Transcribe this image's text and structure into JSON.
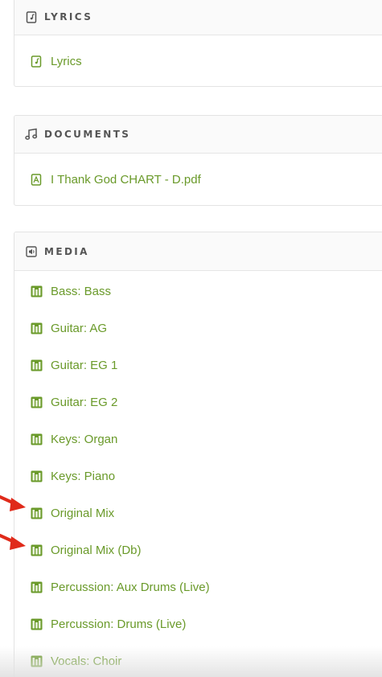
{
  "colors": {
    "link_green": "#6a9a2a",
    "header_text": "#555555",
    "border": "#e3e3e3",
    "arrow_red": "#e02a1a"
  },
  "lyrics": {
    "header_icon": "lyrics-file-icon",
    "title": "LYRICS",
    "items": [
      {
        "label": "Lyrics",
        "icon": "lyrics-file-icon"
      }
    ]
  },
  "documents": {
    "header_icon": "music-note-icon",
    "title": "DOCUMENTS",
    "items": [
      {
        "label": "I Thank God CHART - D.pdf",
        "icon": "pdf-file-icon"
      }
    ]
  },
  "media": {
    "header_icon": "speaker-icon",
    "title": "MEDIA",
    "items": [
      {
        "label": "Bass: Bass",
        "icon": "audio-grid-icon"
      },
      {
        "label": "Guitar: AG",
        "icon": "audio-grid-icon"
      },
      {
        "label": "Guitar: EG 1",
        "icon": "audio-grid-icon"
      },
      {
        "label": "Guitar: EG 2",
        "icon": "audio-grid-icon"
      },
      {
        "label": "Keys: Organ",
        "icon": "audio-grid-icon"
      },
      {
        "label": "Keys: Piano",
        "icon": "audio-grid-icon"
      },
      {
        "label": "Original Mix",
        "icon": "audio-grid-icon"
      },
      {
        "label": "Original Mix (Db)",
        "icon": "audio-grid-icon"
      },
      {
        "label": "Percussion: Aux Drums (Live)",
        "icon": "audio-grid-icon"
      },
      {
        "label": "Percussion: Drums (Live)",
        "icon": "audio-grid-icon"
      },
      {
        "label": "Vocals: Choir",
        "icon": "audio-grid-icon"
      }
    ]
  }
}
